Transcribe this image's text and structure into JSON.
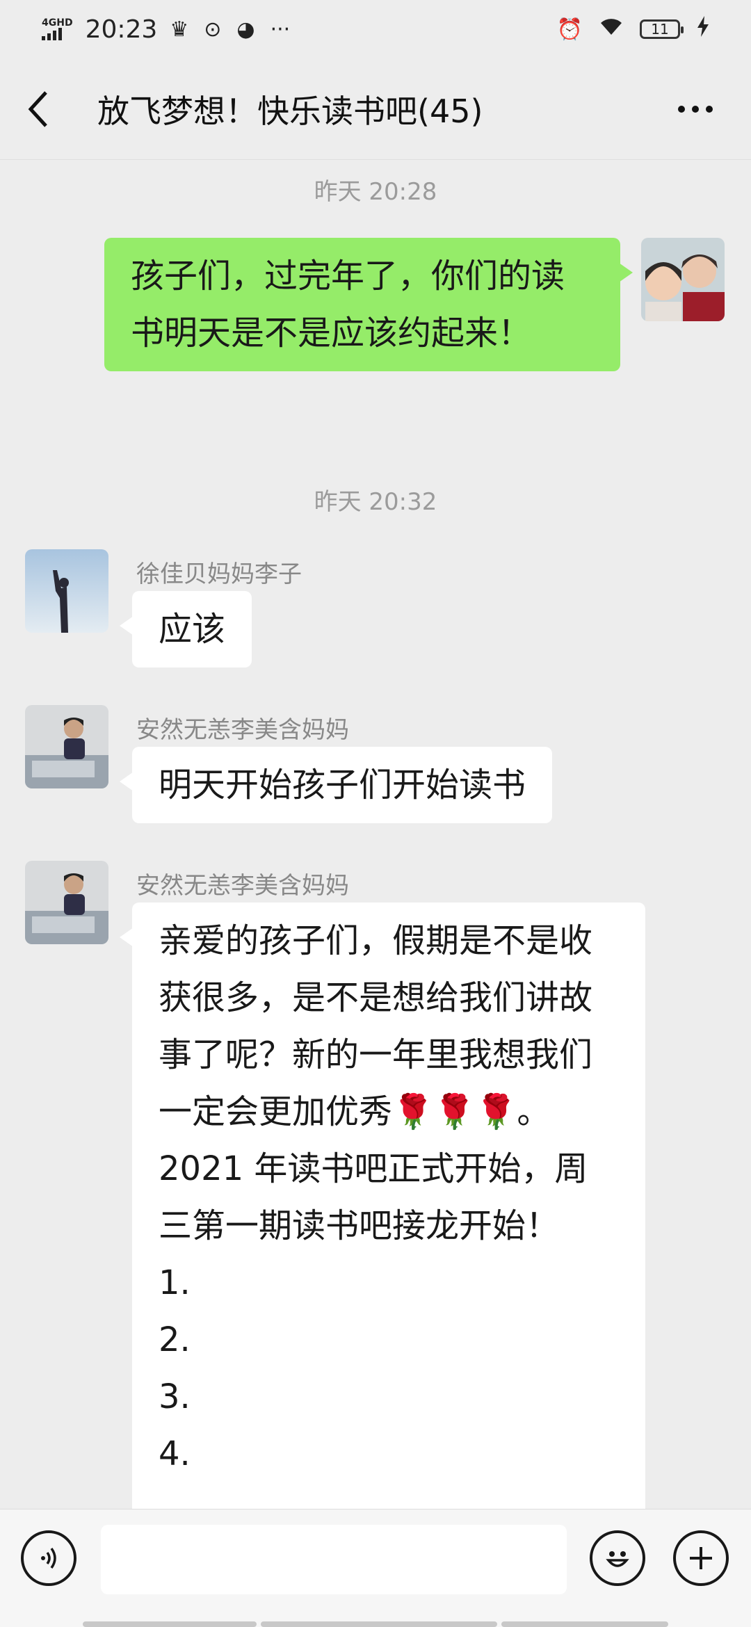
{
  "status_bar": {
    "network": "4GHD",
    "time": "20:23",
    "battery": "11"
  },
  "header": {
    "title": "放飞梦想！快乐读书吧(45)"
  },
  "messages": {
    "ts1": "昨天 20:28",
    "msg1": "孩子们，过完年了，你们的读书明天是不是应该约起来！",
    "ts2": "昨天 20:32",
    "sender2": "徐佳贝妈妈李子",
    "msg2": "应该",
    "sender3": "安然无恙李美含妈妈",
    "msg3": "明天开始孩子们开始读书",
    "sender4": "安然无恙李美含妈妈",
    "msg4_part1": "亲爱的孩子们，假期是不是收获很多，是不是想给我们讲故事了呢？新的一年里我想我们一定会更加优秀",
    "msg4_rose": "🌹🌹🌹",
    "msg4_part2": "。2021 年读书吧正式开始，周三第一期读书吧接龙开始！",
    "msg4_list": [
      "1.",
      "2.",
      "3.",
      "4."
    ]
  },
  "input_bar": {
    "placeholder": ""
  },
  "colors": {
    "my_bubble": "#95ec69",
    "other_bubble": "#ffffff",
    "background": "#ededed"
  }
}
